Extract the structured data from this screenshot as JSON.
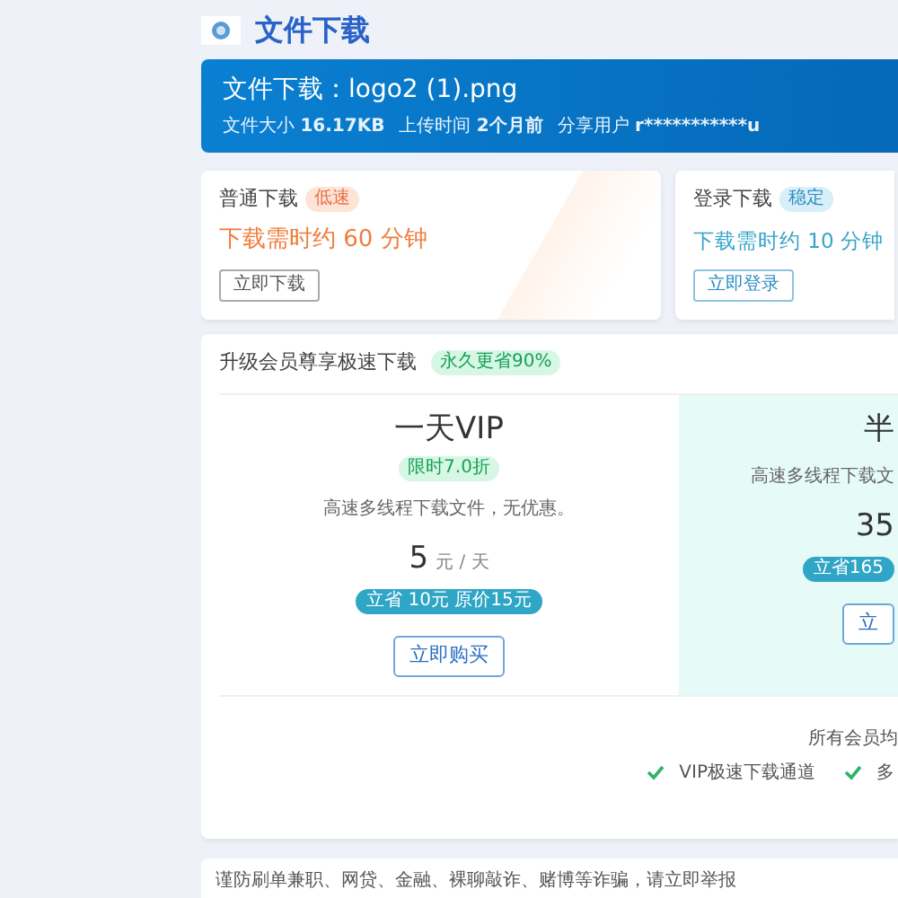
{
  "header": {
    "title": "文件下载"
  },
  "file": {
    "title": "文件下载：logo2 (1).png",
    "meta": [
      {
        "label": "文件大小",
        "value": "16.17KB"
      },
      {
        "label": "上传时间",
        "value": "2个月前"
      },
      {
        "label": "分享用户",
        "value": "r***********u"
      }
    ]
  },
  "download_options": [
    {
      "kind": "slow",
      "title": "普通下载",
      "tag": "低速",
      "time": "下载需时约 60 分钟",
      "button": "立即下载"
    },
    {
      "kind": "stable",
      "title": "登录下载",
      "tag": "稳定",
      "time": "下载需时约 10 分钟",
      "button": "立即登录"
    }
  ],
  "membership": {
    "title": "升级会员尊享极速下载",
    "tag": "永久更省90%",
    "plans": [
      {
        "name": "一天VIP",
        "discount": "限时7.0折",
        "description": "高速多线程下载文件，无优惠。",
        "price": "5",
        "unit": "元 / 天",
        "savings": "立省 10元 原价15元",
        "button": "立即购买",
        "selected": false
      },
      {
        "name": "半",
        "description": "高速多线程下载文",
        "price": "35",
        "savings": "立省165",
        "button": "立",
        "selected": true
      }
    ],
    "benefits_title": "所有会员均",
    "benefits": [
      "VIP极速下载通道",
      "多"
    ]
  },
  "notice": "谨防刷单兼职、网贷、金融、裸聊敲诈、赌博等诈骗，请立即举报"
}
